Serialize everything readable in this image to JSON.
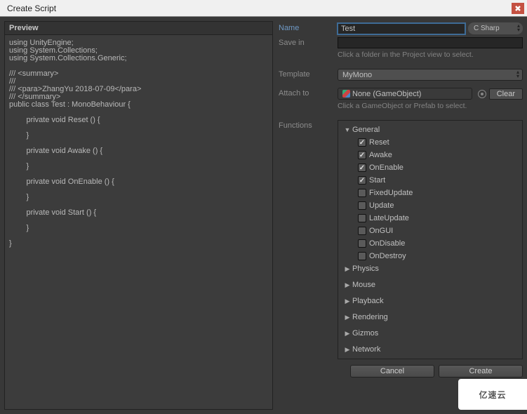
{
  "window": {
    "title": "Create Script"
  },
  "preview": {
    "label": "Preview",
    "code": "using UnityEngine;\nusing System.Collections;\nusing System.Collections.Generic;\n\n/// <summary>\n/// \n/// <para>ZhangYu 2018-07-09</para>\n/// </summary>\npublic class Test : MonoBehaviour {\n\n\tprivate void Reset () {\n\t\t\n\t}\n\n\tprivate void Awake () {\n\t\t\n\t}\n\n\tprivate void OnEnable () {\n\t\t\n\t}\n\n\tprivate void Start () {\n\t\t\n\t}\n\n}"
  },
  "form": {
    "name_label": "Name",
    "name_value": "Test",
    "language": "C Sharp",
    "savein_label": "Save in",
    "savein_value": "",
    "savein_hint": "Click a folder in the Project view to select.",
    "template_label": "Template",
    "template_value": "MyMono",
    "attach_label": "Attach to",
    "attach_value": "None (GameObject)",
    "attach_hint": "Click a GameObject or Prefab to select.",
    "clear_btn": "Clear",
    "functions_label": "Functions"
  },
  "functions": {
    "groups": [
      {
        "label": "General",
        "expanded": true,
        "items": [
          {
            "label": "Reset",
            "on": true
          },
          {
            "label": "Awake",
            "on": true
          },
          {
            "label": "OnEnable",
            "on": true
          },
          {
            "label": "Start",
            "on": true
          },
          {
            "label": "FixedUpdate",
            "on": false
          },
          {
            "label": "Update",
            "on": false
          },
          {
            "label": "LateUpdate",
            "on": false
          },
          {
            "label": "OnGUI",
            "on": false
          },
          {
            "label": "OnDisable",
            "on": false
          },
          {
            "label": "OnDestroy",
            "on": false
          }
        ]
      },
      {
        "label": "Physics",
        "expanded": false
      },
      {
        "label": "Mouse",
        "expanded": false
      },
      {
        "label": "Playback",
        "expanded": false
      },
      {
        "label": "Rendering",
        "expanded": false
      },
      {
        "label": "Gizmos",
        "expanded": false
      },
      {
        "label": "Network",
        "expanded": false
      }
    ]
  },
  "buttons": {
    "cancel": "Cancel",
    "create": "Create"
  },
  "watermark": "亿速云"
}
